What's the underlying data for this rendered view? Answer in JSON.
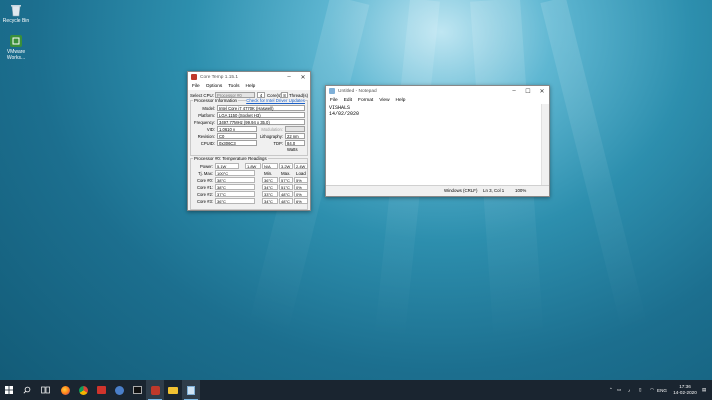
{
  "desktop": {
    "icons": [
      {
        "label": "Recycle Bin"
      },
      {
        "label": "VMware Workstation",
        "label_display": "VMware Works..."
      }
    ]
  },
  "coretemp": {
    "title": "Core Temp 1.15.1",
    "menu": [
      "File",
      "Options",
      "Tools",
      "Help"
    ],
    "select_cpu_label": "Select CPU:",
    "select_cpu_value": "Processor #0",
    "cores_value": "4",
    "cores_label": "Core(s)",
    "threads_value": "8",
    "threads_label": "Thread(s)",
    "proc_info_label": "Processor Information",
    "driver_link": "Check for Intel Driver Updates",
    "model_label": "Model:",
    "model_value": "Intel Core i7 4770K (Haswell)",
    "platform_label": "Platform:",
    "platform_value": "LGA 1150 (Socket H3)",
    "frequency_label": "Frequency:",
    "frequency_value": "3497.77MHz (99.94 x 35.0)",
    "vid_label": "VID:",
    "vid_value": "1.0610 v",
    "modulation_label": "Modulation:",
    "revision_label": "Revision:",
    "revision_value": "C0",
    "lithography_label": "Lithography:",
    "lithography_value": "22 nm",
    "cpuid_label": "CPUID:",
    "cpuid_value": "0x306C3",
    "tdp_label": "TDP:",
    "tdp_value": "84.0 Watts",
    "temps_label": "Processor #0: Temperature Readings",
    "power_label": "Power:",
    "power_values": [
      "5.1W",
      "1.8W",
      "N/A",
      "3.2W",
      "2.4W"
    ],
    "tjmax_label": "Tj. Max:",
    "tjmax_value": "100°C",
    "col_headers": [
      "Min.",
      "Max.",
      "Load"
    ],
    "cores": [
      {
        "label": "Core #0:",
        "temp": "38°C",
        "min": "36°C",
        "max": "57°C",
        "load": "5%"
      },
      {
        "label": "Core #1:",
        "temp": "38°C",
        "min": "34°C",
        "max": "51°C",
        "load": "0%"
      },
      {
        "label": "Core #2:",
        "temp": "37°C",
        "min": "33°C",
        "max": "48°C",
        "load": "0%"
      },
      {
        "label": "Core #3:",
        "temp": "36°C",
        "min": "34°C",
        "max": "48°C",
        "load": "6%"
      }
    ]
  },
  "notepad": {
    "title": "Untitled - Notepad",
    "menu": [
      "File",
      "Edit",
      "Format",
      "View",
      "Help"
    ],
    "lines": [
      "VISHALS",
      "14/02/2020"
    ],
    "status_encoding": "Windows (CRLF)",
    "status_position": "Ln 3, Col 1",
    "status_zoom": "100%"
  },
  "taskbar": {
    "lang": "ENG",
    "time": "17:36",
    "date": "14-02-2020"
  },
  "colors": {
    "taskbar_bg": "#1a2530",
    "accent": "#79b8e6"
  }
}
